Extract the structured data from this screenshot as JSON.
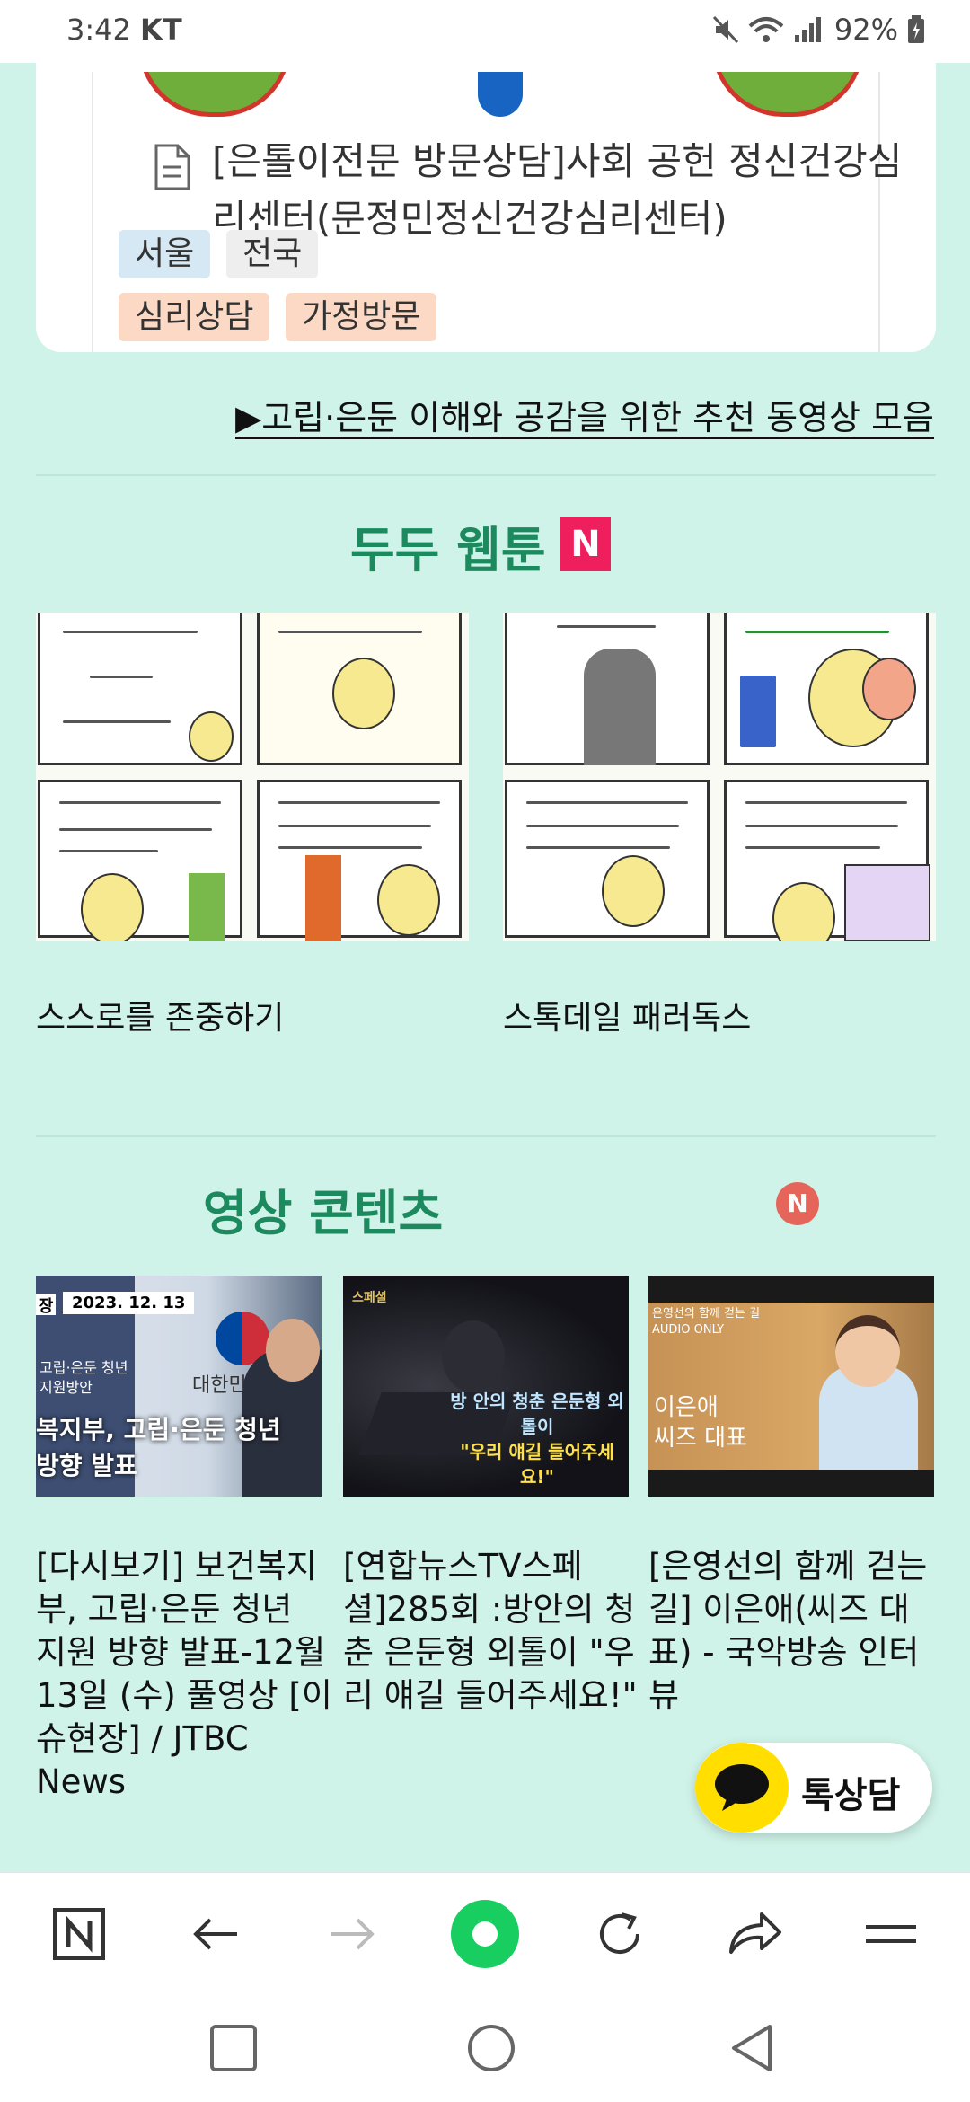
{
  "status_bar": {
    "time": "3:42",
    "carrier": "KT",
    "battery": "92%",
    "icons": [
      "mute-icon",
      "wifi-icon",
      "signal-icon",
      "battery-icon"
    ]
  },
  "top_card": {
    "title": "[은톨이전문 방문상담]사회 공헌 정신건강심리센터(문정민정신건강심리센터)",
    "tags": [
      {
        "label": "서울",
        "color": "#d5e8f4"
      },
      {
        "label": "전국",
        "color": "#eeeeee"
      },
      {
        "label": "심리상담",
        "color": "#fbd9c4"
      },
      {
        "label": "가정방문",
        "color": "#fbd9c4"
      }
    ]
  },
  "video_link": "▶고립·은둔 이해와 공감을 위한 추천 동영상 모음",
  "webtoon_section": {
    "title": "두두 웹툰",
    "badge": "N",
    "items": [
      {
        "caption": "스스로를 존중하기"
      },
      {
        "caption": "스톡데일 패러독스"
      }
    ]
  },
  "video_section": {
    "title": "영상 콘텐츠",
    "badge": "N",
    "items": [
      {
        "thumb_date": "2023. 12. 13",
        "thumb_line1": "복지부, 고립·은둔 청년",
        "thumb_line2": "방향 발표",
        "thumb_corner": "장",
        "thumb_org": "대한민국정",
        "thumb_sub": "고립·은둔 청년",
        "thumb_sub2": "지원방안",
        "caption": "[다시보기] 보건복지부, 고립·은둔 청년 지원 방향 발표-12월 13일 (수) 풀영상 [이슈현장] / JTBC News"
      },
      {
        "thumb_line1": "방 안의 청춘 은둔형 외톨이",
        "thumb_line2": "\"우리 얘길 들어주세요!\"",
        "thumb_corner": "스페셜",
        "caption": "[연합뉴스TV스페셜]285회 :방안의 청춘 은둔형 외톨이 \"우리 얘길 들어주세요!\""
      },
      {
        "thumb_line1": "은영선의 함께 걷는 길",
        "thumb_line2": "AUDIO ONLY",
        "thumb_name": "이은애",
        "thumb_role": "씨즈 대표",
        "caption": "[은영선의 함께 걷는 길] 이은애(씨즈 대표) - 국악방송 인터뷰"
      }
    ]
  },
  "chat_button": {
    "label": "톡상담"
  },
  "browser_toolbar": {
    "items": [
      "naver-home-icon",
      "back-icon",
      "forward-icon",
      "green-dot-icon",
      "reload-icon",
      "share-icon",
      "menu-icon"
    ],
    "naver_label": "N"
  },
  "colors": {
    "background": "#cff3e8",
    "section_title": "#1c8a5e",
    "badge_pink": "#ee1f5c",
    "chat_yellow": "#ffde00"
  }
}
